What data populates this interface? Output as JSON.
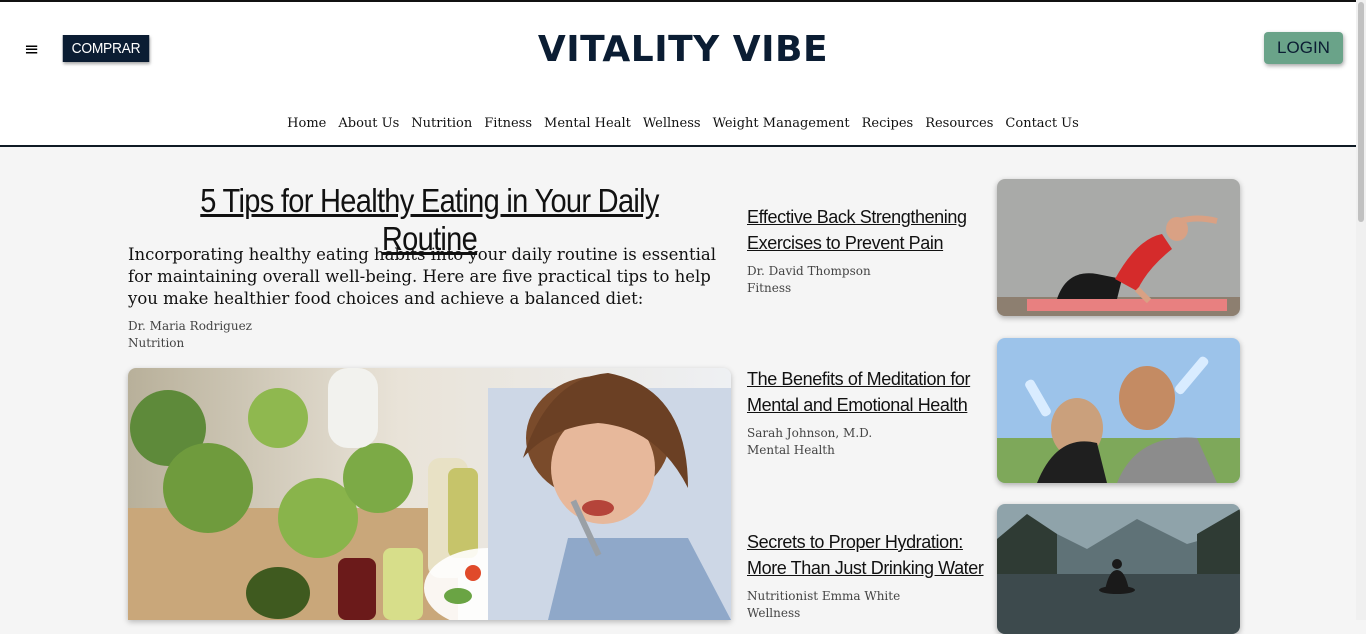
{
  "header": {
    "menu_icon": "≡",
    "buy_label": "COMPRAR",
    "brand": "VITALITY VIBE",
    "login_label": "LOGIN"
  },
  "nav": [
    "Home",
    "About Us",
    "Nutrition",
    "Fitness",
    "Mental Healt",
    "Wellness",
    "Weight Management",
    "Recipes",
    "Resources",
    "Contact Us"
  ],
  "main_article": {
    "title": "5 Tips for Healthy Eating in Your Daily Routine",
    "intro": "Incorporating healthy eating habits into your daily routine is essential for maintaining overall well-being. Here are five practical tips to help you make healthier food choices and achieve a balanced diet:",
    "author": "Dr. Maria Rodriguez",
    "category": "Nutrition"
  },
  "side_articles": [
    {
      "title": "Effective Back Strengthening Exercises to Prevent Pain",
      "author": "Dr. David Thompson",
      "category": "Fitness"
    },
    {
      "title": "The Benefits of Meditation for Mental and Emotional Health",
      "author": "Sarah Johnson, M.D.",
      "category": "Mental Health"
    },
    {
      "title": "Secrets to Proper Hydration: More Than Just Drinking Water",
      "author": "Nutritionist Emma White",
      "category": "Wellness"
    }
  ],
  "colors": {
    "brand": "#0b1d33",
    "login_bg": "#6aa389",
    "page_bg": "#f5f5f5"
  }
}
